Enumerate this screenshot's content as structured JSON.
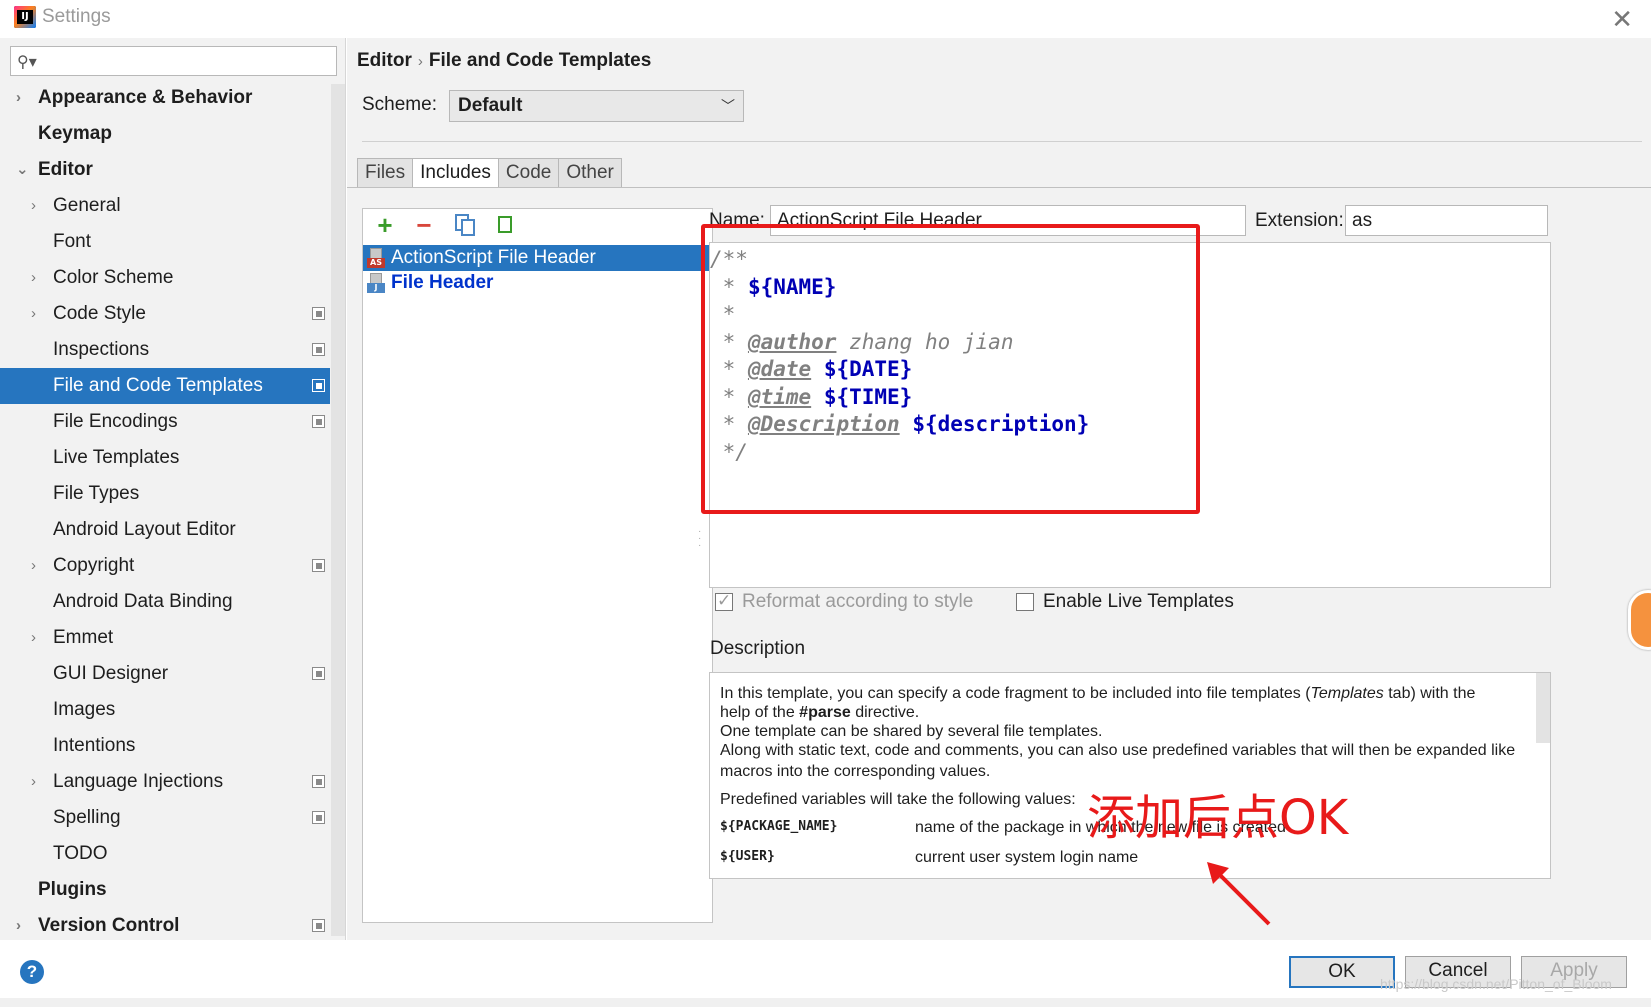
{
  "window": {
    "title": "Settings"
  },
  "search": {
    "placeholder": ""
  },
  "sidebar": {
    "items": [
      {
        "label": "Appearance & Behavior",
        "level": 0,
        "arrow": "›",
        "icon": false
      },
      {
        "label": "Keymap",
        "level": 0,
        "arrow": "",
        "icon": false
      },
      {
        "label": "Editor",
        "level": 0,
        "arrow": "⌄",
        "icon": false
      },
      {
        "label": "General",
        "level": 1,
        "arrow": "›",
        "icon": false
      },
      {
        "label": "Font",
        "level": 1,
        "arrow": "",
        "icon": false
      },
      {
        "label": "Color Scheme",
        "level": 1,
        "arrow": "›",
        "icon": false
      },
      {
        "label": "Code Style",
        "level": 1,
        "arrow": "›",
        "icon": true
      },
      {
        "label": "Inspections",
        "level": 1,
        "arrow": "",
        "icon": true
      },
      {
        "label": "File and Code Templates",
        "level": 1,
        "arrow": "",
        "icon": true,
        "selected": true
      },
      {
        "label": "File Encodings",
        "level": 1,
        "arrow": "",
        "icon": true
      },
      {
        "label": "Live Templates",
        "level": 1,
        "arrow": "",
        "icon": false
      },
      {
        "label": "File Types",
        "level": 1,
        "arrow": "",
        "icon": false
      },
      {
        "label": "Android Layout Editor",
        "level": 1,
        "arrow": "",
        "icon": false
      },
      {
        "label": "Copyright",
        "level": 1,
        "arrow": "›",
        "icon": true
      },
      {
        "label": "Android Data Binding",
        "level": 1,
        "arrow": "",
        "icon": false
      },
      {
        "label": "Emmet",
        "level": 1,
        "arrow": "›",
        "icon": false
      },
      {
        "label": "GUI Designer",
        "level": 1,
        "arrow": "",
        "icon": true
      },
      {
        "label": "Images",
        "level": 1,
        "arrow": "",
        "icon": false
      },
      {
        "label": "Intentions",
        "level": 1,
        "arrow": "",
        "icon": false
      },
      {
        "label": "Language Injections",
        "level": 1,
        "arrow": "›",
        "icon": true
      },
      {
        "label": "Spelling",
        "level": 1,
        "arrow": "",
        "icon": true
      },
      {
        "label": "TODO",
        "level": 1,
        "arrow": "",
        "icon": false
      },
      {
        "label": "Plugins",
        "level": 0,
        "arrow": "",
        "icon": false
      },
      {
        "label": "Version Control",
        "level": 0,
        "arrow": "›",
        "icon": true
      }
    ]
  },
  "breadcrumb": {
    "parent": "Editor",
    "separator": "›",
    "current": "File and Code Templates"
  },
  "scheme": {
    "label": "Scheme:",
    "value": "Default"
  },
  "tabs": [
    {
      "label": "Files",
      "active": false
    },
    {
      "label": "Includes",
      "active": true
    },
    {
      "label": "Code",
      "active": false
    },
    {
      "label": "Other",
      "active": false
    }
  ],
  "templates": [
    {
      "label": "ActionScript File Header",
      "tag": "AS",
      "tag_color": "#c0392b",
      "selected": true
    },
    {
      "label": "File Header",
      "tag": "J",
      "tag_color": "#4a86c5",
      "selected": false
    }
  ],
  "form": {
    "name_label": "Name:",
    "name_value": "ActionScript File Header",
    "ext_label": "Extension:",
    "ext_value": "as"
  },
  "code": {
    "l1": "/**",
    "l2_star": " * ",
    "l2_var": "${NAME}",
    "l3": " *",
    "l4_star": " * ",
    "l4_tag": "@author",
    "l4_text": " zhang ho jian",
    "l5_star": " * ",
    "l5_tag": "@date",
    "l5_var": "${DATE}",
    "l6_star": " * ",
    "l6_tag": "@time",
    "l6_var": "${TIME}",
    "l7_star": " * ",
    "l7_tag": "@Description",
    "l7_var": "${description}",
    "l8": " */"
  },
  "options": {
    "reformat_label": "Reformat according to style",
    "reformat_checked": true,
    "live_label": "Enable Live Templates",
    "live_checked": false
  },
  "description": {
    "label": "Description",
    "p1_a": "In this template, you can specify a code fragment to be included into file templates (",
    "p1_em": "Templates",
    "p1_b": " tab) with the",
    "p1_c": "help of the ",
    "p1_strong": "#parse",
    "p1_d": " directive.",
    "p2": "One template can be shared by several file templates.",
    "p3": "Along with static text, code and comments, you can also use predefined variables that will then be expanded like",
    "p3b": "macros into the corresponding values.",
    "p4": "Predefined variables will take the following values:",
    "vars": [
      {
        "name": "${PACKAGE_NAME}",
        "desc": "name of the package in which the new file is created"
      },
      {
        "name": "${USER}",
        "desc": "current user system login name"
      }
    ]
  },
  "annotation": {
    "text": "添加后点OK",
    "color": "#e81a1a"
  },
  "buttons": {
    "ok": "OK",
    "cancel": "Cancel",
    "apply": "Apply",
    "help": "?"
  },
  "watermark": "https://blog.csdn.net/Pitton_of_Bloom",
  "colors": {
    "selection": "#2675bf",
    "code_var": "#0000b4",
    "highlight": "#e81a1a"
  }
}
